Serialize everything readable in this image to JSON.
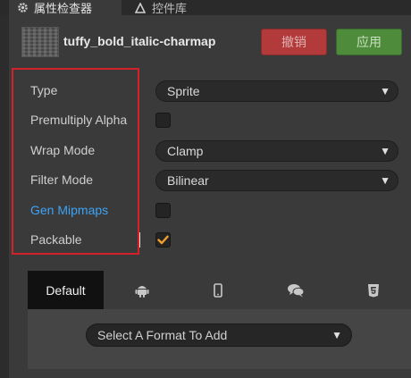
{
  "tabs": [
    {
      "label": "属性检查器",
      "icon": "gear-icon"
    },
    {
      "label": "控件库",
      "icon": "triangle-icon"
    }
  ],
  "asset": {
    "name": "tuffy_bold_italic-charmap",
    "revert_label": "撤销",
    "apply_label": "应用"
  },
  "properties": {
    "type": {
      "label": "Type",
      "value": "Sprite"
    },
    "premultiply_alpha": {
      "label": "Premultiply Alpha",
      "checked": false
    },
    "wrap_mode": {
      "label": "Wrap Mode",
      "value": "Clamp"
    },
    "filter_mode": {
      "label": "Filter Mode",
      "value": "Bilinear"
    },
    "gen_mipmaps": {
      "label": "Gen Mipmaps",
      "checked": false
    },
    "packable": {
      "label": "Packable",
      "checked": true
    }
  },
  "platforms": {
    "tabs": [
      {
        "label": "Default",
        "icon": "default"
      },
      {
        "label": "",
        "icon": "android-icon"
      },
      {
        "label": "",
        "icon": "mobile-icon"
      },
      {
        "label": "",
        "icon": "wechat-icon"
      },
      {
        "label": "",
        "icon": "html5-icon"
      }
    ],
    "format_placeholder": "Select A Format To Add"
  },
  "colors": {
    "accent_link": "#3ea3f5",
    "check_orange": "#f0a030",
    "revert": "#b23a3a",
    "apply": "#4e8c3c",
    "highlight": "#d3202a"
  }
}
